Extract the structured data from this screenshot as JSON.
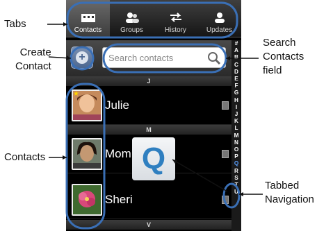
{
  "annotations": {
    "tabs": "Tabs",
    "create_contact": [
      "Create",
      "Contact"
    ],
    "contacts": "Contacts",
    "search_field": [
      "Search",
      "Contacts",
      "field"
    ],
    "tabbed_nav": [
      "Tabbed",
      "Navigation"
    ]
  },
  "tabs": [
    {
      "label": "Contacts",
      "icon": "contacts-icon",
      "active": true
    },
    {
      "label": "Groups",
      "icon": "groups-icon",
      "active": false
    },
    {
      "label": "History",
      "icon": "history-icon",
      "active": false
    },
    {
      "label": "Updates",
      "icon": "updates-icon",
      "active": false
    }
  ],
  "search": {
    "placeholder": "Search contacts"
  },
  "sections": [
    "J",
    "M",
    "V"
  ],
  "contacts": [
    {
      "name": "Julie",
      "favorite": true
    },
    {
      "name": "Mom",
      "favorite": false
    },
    {
      "name": "Sheri",
      "favorite": false
    }
  ],
  "index_letters": [
    "#",
    "A",
    "B",
    "C",
    "D",
    "E",
    "F",
    "G",
    "H",
    "I",
    "J",
    "K",
    "L",
    "M",
    "N",
    "O",
    "P",
    "Q",
    "R",
    "S",
    "T",
    "U"
  ],
  "popup_letter": "Q",
  "colors": {
    "annotation": "#3a6fb5",
    "highlight": "#5aa0ff"
  }
}
